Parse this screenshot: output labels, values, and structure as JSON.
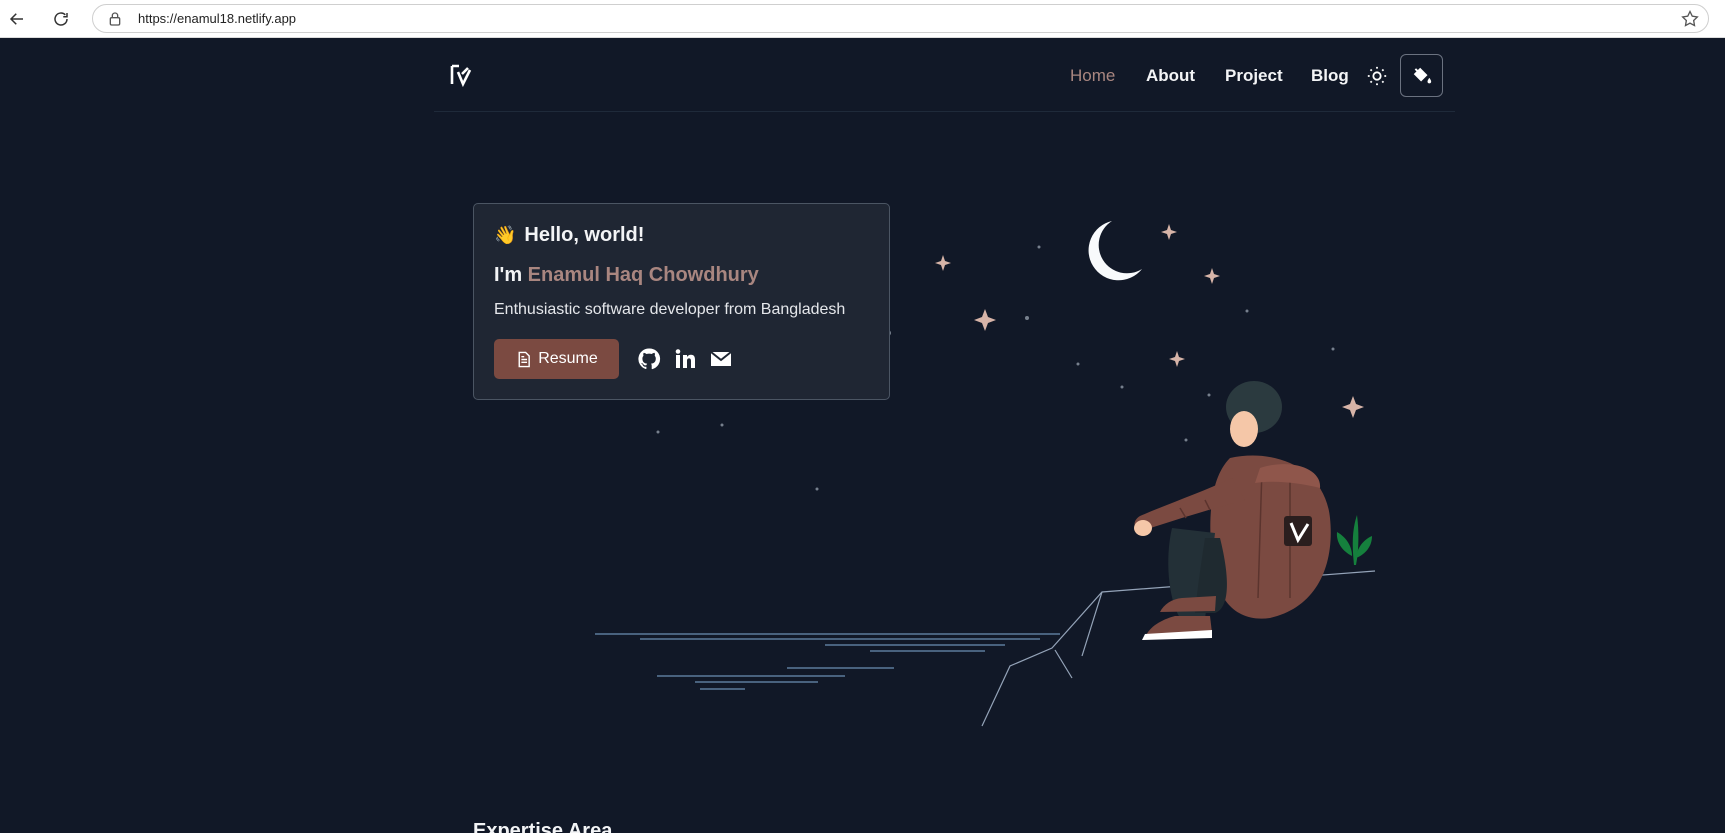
{
  "browser": {
    "url": "https://enamul18.netlify.app"
  },
  "nav": {
    "items": [
      {
        "label": "Home",
        "active": true
      },
      {
        "label": "About",
        "active": false
      },
      {
        "label": "Project",
        "active": false
      },
      {
        "label": "Blog",
        "active": false
      }
    ]
  },
  "hero": {
    "greeting": "Hello, world!",
    "intro_prefix": "I'm",
    "name": "Enamul Haq Chowdhury",
    "tagline": "Enthusiastic software developer from Bangladesh",
    "resume_label": "Resume"
  },
  "icons": {
    "back": "arrow-left-icon",
    "reload": "reload-icon",
    "lock": "lock-icon",
    "bookmark": "star-icon",
    "logo": "logo-icon",
    "theme": "sun-icon",
    "paint": "paint-bucket-icon",
    "resume": "document-icon",
    "github": "github-icon",
    "linkedin": "linkedin-icon",
    "email": "mail-icon"
  },
  "colors": {
    "background": "#111827",
    "accent": "#a98680",
    "button": "#7b4a41",
    "card": "#1f2633"
  },
  "next_section": {
    "heading": "Expertise Area"
  }
}
